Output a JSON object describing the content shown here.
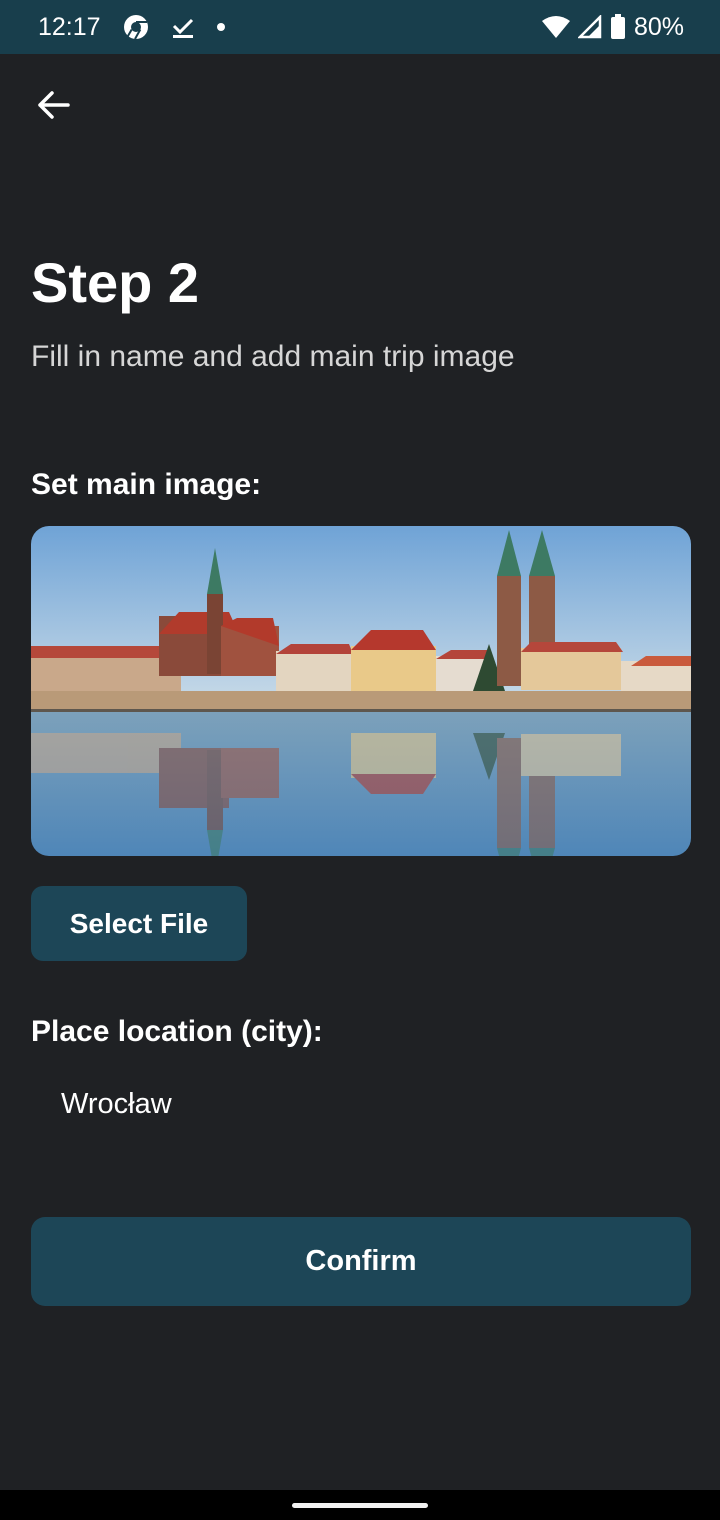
{
  "status_bar": {
    "time": "12:17",
    "icons": [
      "chrome-icon",
      "download-done-icon",
      "notification-dot-icon",
      "wifi-icon",
      "cell-signal-icon",
      "battery-icon"
    ],
    "battery_percent": "80%"
  },
  "header": {
    "back_icon": "arrow-back-icon"
  },
  "main": {
    "title": "Step 2",
    "subtitle": "Fill in name and add main trip image",
    "image_label": "Set main image:",
    "select_file_label": "Select File",
    "city_label": "Place location (city):",
    "city_value": "Wrocław",
    "confirm_label": "Confirm"
  },
  "colors": {
    "background": "#1f2124",
    "status_bar": "#183e4c",
    "button": "#1d4657",
    "text": "#ffffff",
    "subtitle_text": "#d6d6d6"
  }
}
